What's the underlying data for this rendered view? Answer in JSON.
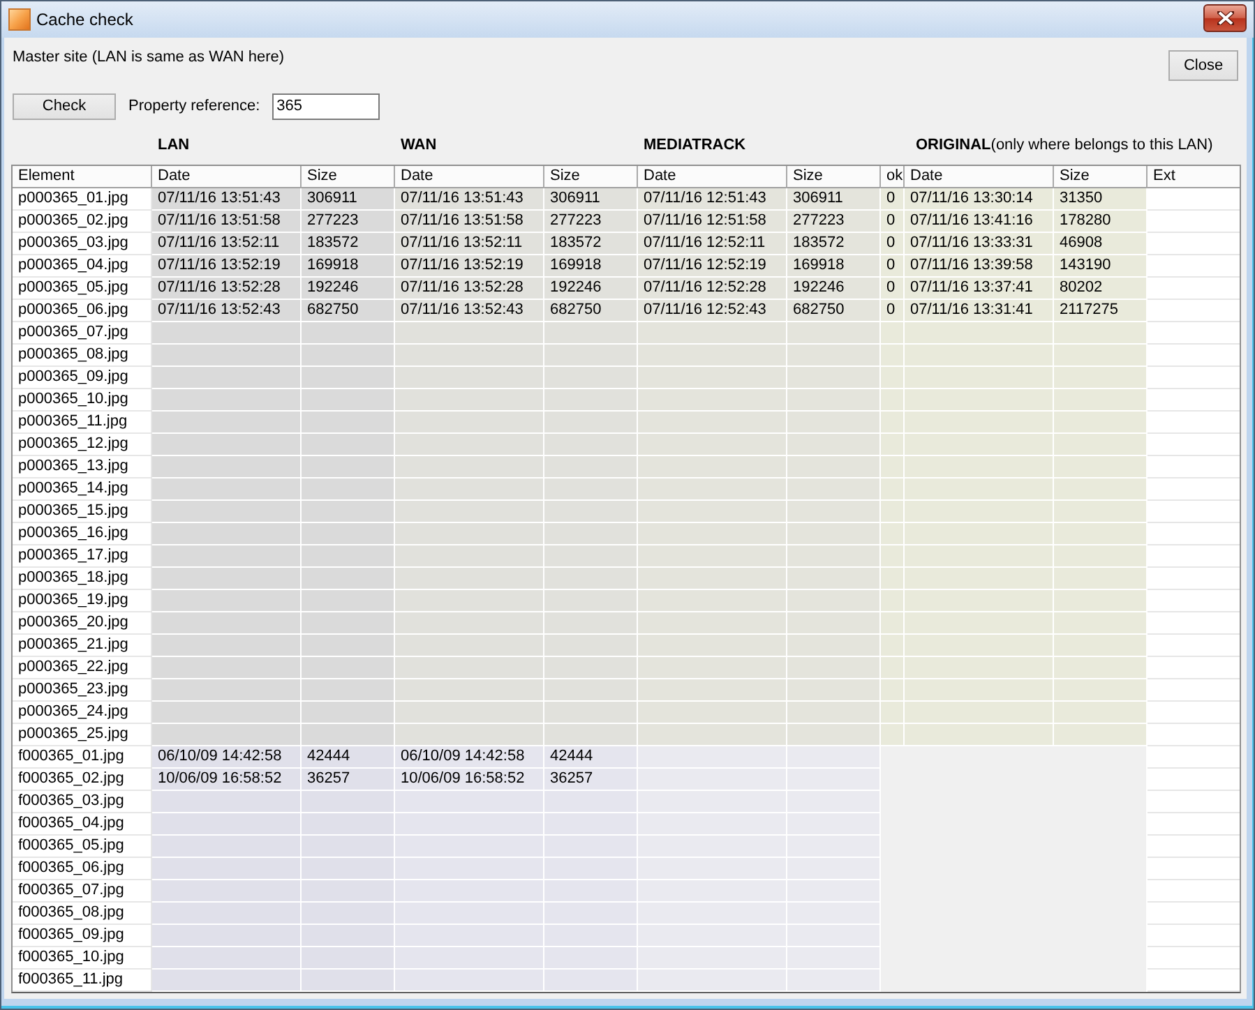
{
  "window": {
    "title": "Cache check"
  },
  "header": {
    "site_note": "Master site (LAN is same as WAN here)",
    "close_button": "Close"
  },
  "toolbar": {
    "check_button": "Check",
    "property_reference": {
      "label": "Property reference:",
      "value": "365"
    }
  },
  "groups": [
    {
      "label": "LAN"
    },
    {
      "label": "WAN"
    },
    {
      "label": "MEDIATRACK"
    },
    {
      "label": "ORIGINAL",
      "note": "(only where belongs to this LAN)"
    }
  ],
  "table": {
    "columns": [
      "Element",
      "Date",
      "Size",
      "Date",
      "Size",
      "Date",
      "Size",
      "ok",
      "Date",
      "Size",
      "Ext"
    ],
    "sections": [
      {
        "rows": [
          {
            "element": "p000365_01.jpg",
            "cells": [
              "07/11/16 13:51:43",
              "306911",
              "07/11/16 13:51:43",
              "306911",
              "07/11/16 12:51:43",
              "306911",
              "0",
              "07/11/16 13:30:14",
              "31350"
            ]
          },
          {
            "element": "p000365_02.jpg",
            "cells": [
              "07/11/16 13:51:58",
              "277223",
              "07/11/16 13:51:58",
              "277223",
              "07/11/16 12:51:58",
              "277223",
              "0",
              "07/11/16 13:41:16",
              "178280"
            ]
          },
          {
            "element": "p000365_03.jpg",
            "cells": [
              "07/11/16 13:52:11",
              "183572",
              "07/11/16 13:52:11",
              "183572",
              "07/11/16 12:52:11",
              "183572",
              "0",
              "07/11/16 13:33:31",
              "46908"
            ]
          },
          {
            "element": "p000365_04.jpg",
            "cells": [
              "07/11/16 13:52:19",
              "169918",
              "07/11/16 13:52:19",
              "169918",
              "07/11/16 12:52:19",
              "169918",
              "0",
              "07/11/16 13:39:58",
              "143190"
            ]
          },
          {
            "element": "p000365_05.jpg",
            "cells": [
              "07/11/16 13:52:28",
              "192246",
              "07/11/16 13:52:28",
              "192246",
              "07/11/16 12:52:28",
              "192246",
              "0",
              "07/11/16 13:37:41",
              "80202"
            ]
          },
          {
            "element": "p000365_06.jpg",
            "cells": [
              "07/11/16 13:52:43",
              "682750",
              "07/11/16 13:52:43",
              "682750",
              "07/11/16 12:52:43",
              "682750",
              "0",
              "07/11/16 13:31:41",
              "2117275"
            ]
          },
          {
            "element": "p000365_07.jpg"
          },
          {
            "element": "p000365_08.jpg"
          },
          {
            "element": "p000365_09.jpg"
          },
          {
            "element": "p000365_10.jpg"
          },
          {
            "element": "p000365_11.jpg"
          },
          {
            "element": "p000365_12.jpg"
          },
          {
            "element": "p000365_13.jpg"
          },
          {
            "element": "p000365_14.jpg"
          },
          {
            "element": "p000365_15.jpg"
          },
          {
            "element": "p000365_16.jpg"
          },
          {
            "element": "p000365_17.jpg"
          },
          {
            "element": "p000365_18.jpg"
          },
          {
            "element": "p000365_19.jpg"
          },
          {
            "element": "p000365_20.jpg"
          },
          {
            "element": "p000365_21.jpg"
          },
          {
            "element": "p000365_22.jpg"
          },
          {
            "element": "p000365_23.jpg"
          },
          {
            "element": "p000365_24.jpg"
          },
          {
            "element": "p000365_25.jpg"
          }
        ]
      },
      {
        "rows": [
          {
            "element": "f000365_01.jpg",
            "cells": [
              "06/10/09 14:42:58",
              "42444",
              "06/10/09 14:42:58",
              "42444"
            ]
          },
          {
            "element": "f000365_02.jpg",
            "cells": [
              "10/06/09 16:58:52",
              "36257",
              "10/06/09 16:58:52",
              "36257"
            ]
          },
          {
            "element": "f000365_03.jpg"
          },
          {
            "element": "f000365_04.jpg"
          },
          {
            "element": "f000365_05.jpg"
          },
          {
            "element": "f000365_06.jpg"
          },
          {
            "element": "f000365_07.jpg"
          },
          {
            "element": "f000365_08.jpg"
          },
          {
            "element": "f000365_09.jpg"
          },
          {
            "element": "f000365_10.jpg"
          },
          {
            "element": "f000365_11.jpg"
          }
        ]
      }
    ]
  }
}
